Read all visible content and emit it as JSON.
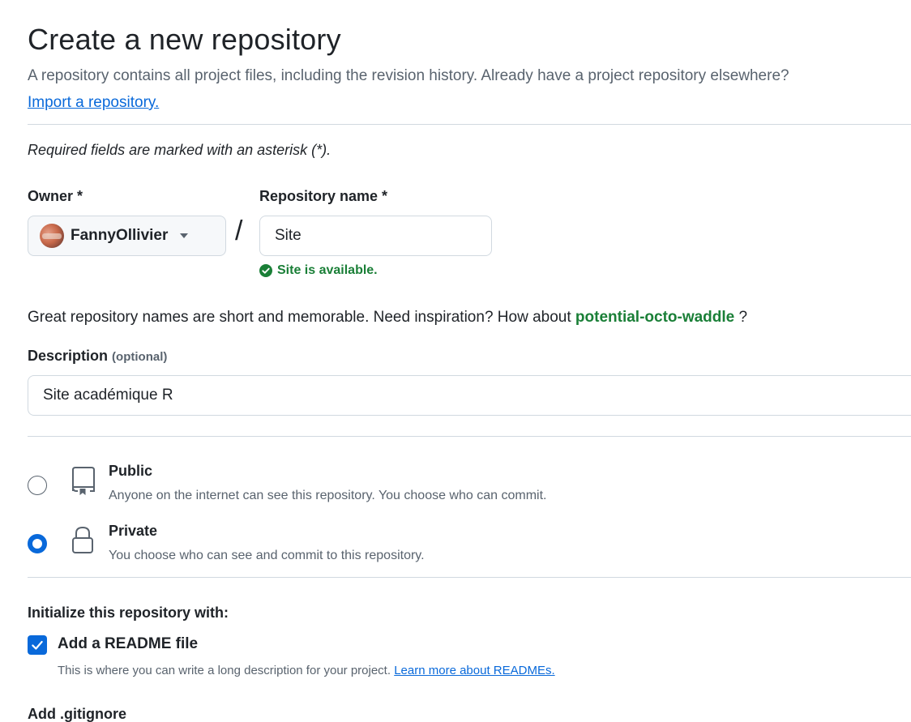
{
  "header": {
    "title": "Create a new repository",
    "intro": "A repository contains all project files, including the revision history. Already have a project repository elsewhere?",
    "import_link": "Import a repository."
  },
  "form": {
    "required_note": "Required fields are marked with an asterisk (*).",
    "owner": {
      "label": "Owner *",
      "value": "FannyOllivier",
      "separator": "/"
    },
    "repo_name": {
      "label": "Repository name *",
      "value": "Site",
      "availability": "Site is available."
    },
    "suggestion": {
      "prefix": "Great repository names are short and memorable. Need inspiration? How about",
      "name": "potential-octo-waddle",
      "suffix": "?"
    },
    "description": {
      "label": "Description",
      "optional": "(optional)",
      "value": "Site académique R"
    },
    "visibility": {
      "selected": "private",
      "options": [
        {
          "id": "public",
          "title": "Public",
          "description": "Anyone on the internet can see this repository. You choose who can commit.",
          "icon": "repo-icon"
        },
        {
          "id": "private",
          "title": "Private",
          "description": "You choose who can see and commit to this repository.",
          "icon": "lock-icon"
        }
      ]
    },
    "initialize": {
      "label": "Initialize this repository with:",
      "readme": {
        "checked": true,
        "title": "Add a README file",
        "description": "This is where you can write a long description for your project.",
        "link": "Learn more about READMEs."
      }
    },
    "gitignore": {
      "label": "Add .gitignore"
    }
  },
  "colors": {
    "accent": "#0969da",
    "success": "#1a7f37",
    "muted": "#59636e",
    "border": "#d1d9e0"
  }
}
